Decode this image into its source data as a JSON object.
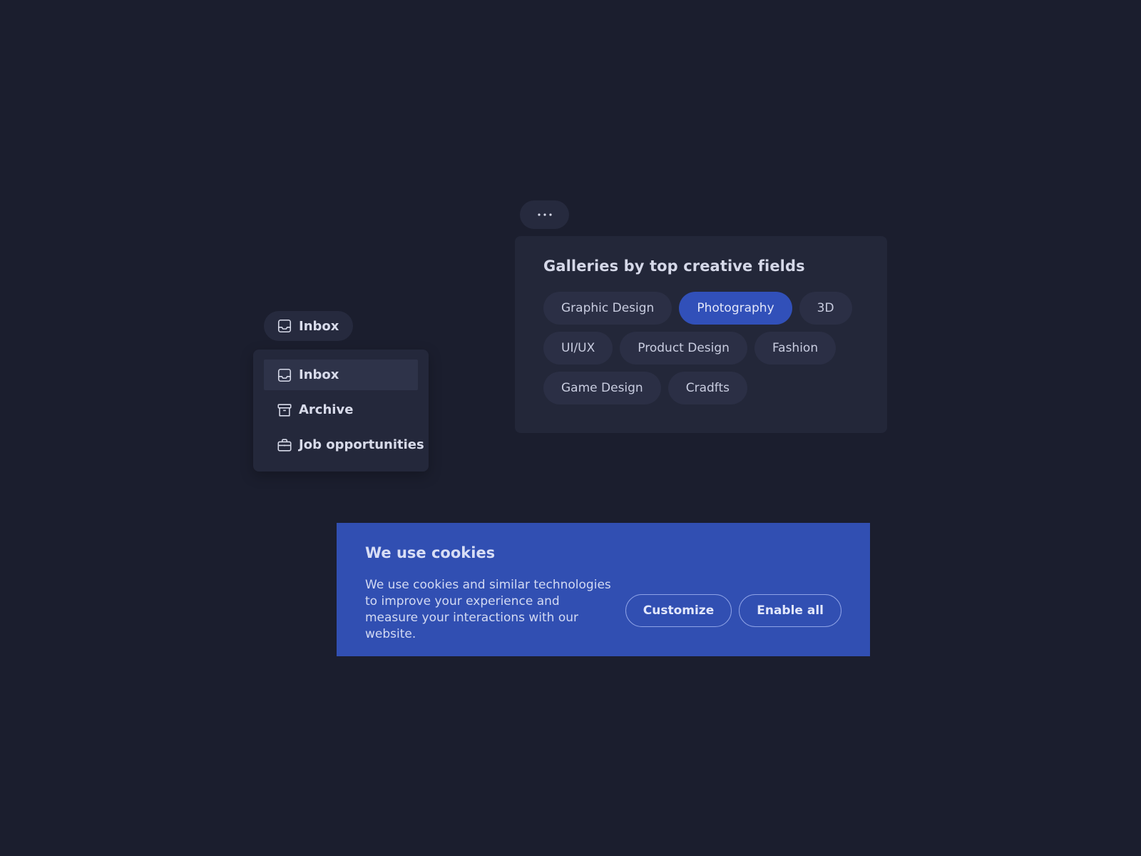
{
  "inbox_dropdown": {
    "trigger_label": "Inbox",
    "items": [
      {
        "label": "Inbox",
        "icon": "inbox-icon",
        "active": true
      },
      {
        "label": "Archive",
        "icon": "archive-icon",
        "active": false
      },
      {
        "label": "Job opportunities",
        "icon": "briefcase-icon",
        "active": false
      }
    ]
  },
  "galleries": {
    "more_label": "···",
    "title": "Galleries by top creative fields",
    "chips": [
      {
        "label": "Graphic Design",
        "selected": false
      },
      {
        "label": "Photography",
        "selected": true
      },
      {
        "label": "3D",
        "selected": false
      },
      {
        "label": "UI/UX",
        "selected": false
      },
      {
        "label": "Product Design",
        "selected": false
      },
      {
        "label": "Fashion",
        "selected": false
      },
      {
        "label": "Game Design",
        "selected": false
      },
      {
        "label": "Cradfts",
        "selected": false
      }
    ]
  },
  "cookies": {
    "title": "We use cookies",
    "text": "We use cookies and similar technologies to improve your experience and measure your interactions with our website.",
    "customize_label": "Customize",
    "enable_all_label": "Enable all"
  },
  "colors": {
    "background": "#1b1e2e",
    "card": "#232739",
    "chip": "#2b2f45",
    "accent": "#3150b9",
    "banner": "#314fb2",
    "text": "#d5d8e8"
  }
}
